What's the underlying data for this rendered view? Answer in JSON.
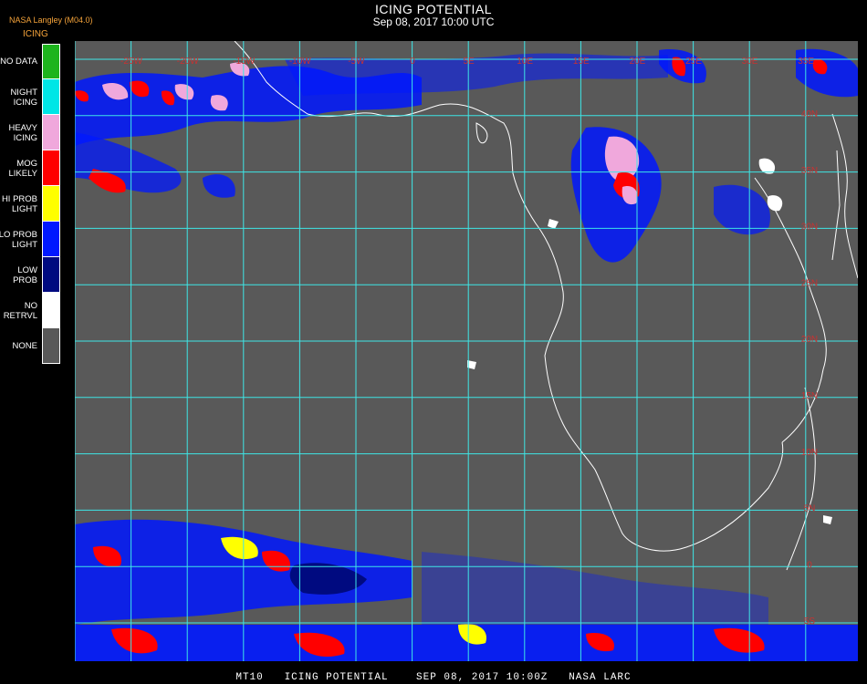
{
  "header": {
    "title": "ICING POTENTIAL",
    "timestamp": "Sep 08, 2017 10:00 UTC"
  },
  "producer": "NASA Langley (M04.0)",
  "legend": {
    "title": "ICING",
    "items": [
      {
        "label": "NO DATA",
        "color": "#1db41d"
      },
      {
        "label": "NIGHT ICING",
        "color": "#00e6e6"
      },
      {
        "label": "HEAVY ICING",
        "color": "#f0a8dc"
      },
      {
        "label": "MOG LIKELY",
        "color": "#ff0000"
      },
      {
        "label": "HI PROB LIGHT",
        "color": "#ffff00"
      },
      {
        "label": "LO PROB LIGHT",
        "color": "#0018ff"
      },
      {
        "label": "LOW PROB",
        "color": "#000a80"
      },
      {
        "label": "NO RETRVL",
        "color": "#ffffff"
      },
      {
        "label": "NONE",
        "color": "#595959"
      }
    ]
  },
  "map": {
    "background_color": "#595959",
    "grid_color": "#3ee6e6",
    "coast_color": "#ffffff",
    "label_color": "#c83232",
    "longitude_labels": [
      "-25W",
      "-20W",
      "-15W",
      "-10W",
      "-5W",
      "0",
      "5E",
      "10E",
      "15E",
      "20E",
      "25E",
      "30E",
      "35E"
    ],
    "latitude_labels": [
      "40N",
      "35N",
      "30N",
      "25N",
      "20N",
      "15N",
      "10N",
      "5N",
      "0",
      "5S",
      "10S",
      "15S",
      "20S",
      "25S",
      "30S"
    ]
  },
  "footer": "MT10   ICING POTENTIAL    SEP 08, 2017 10:00Z   NASA LARC"
}
